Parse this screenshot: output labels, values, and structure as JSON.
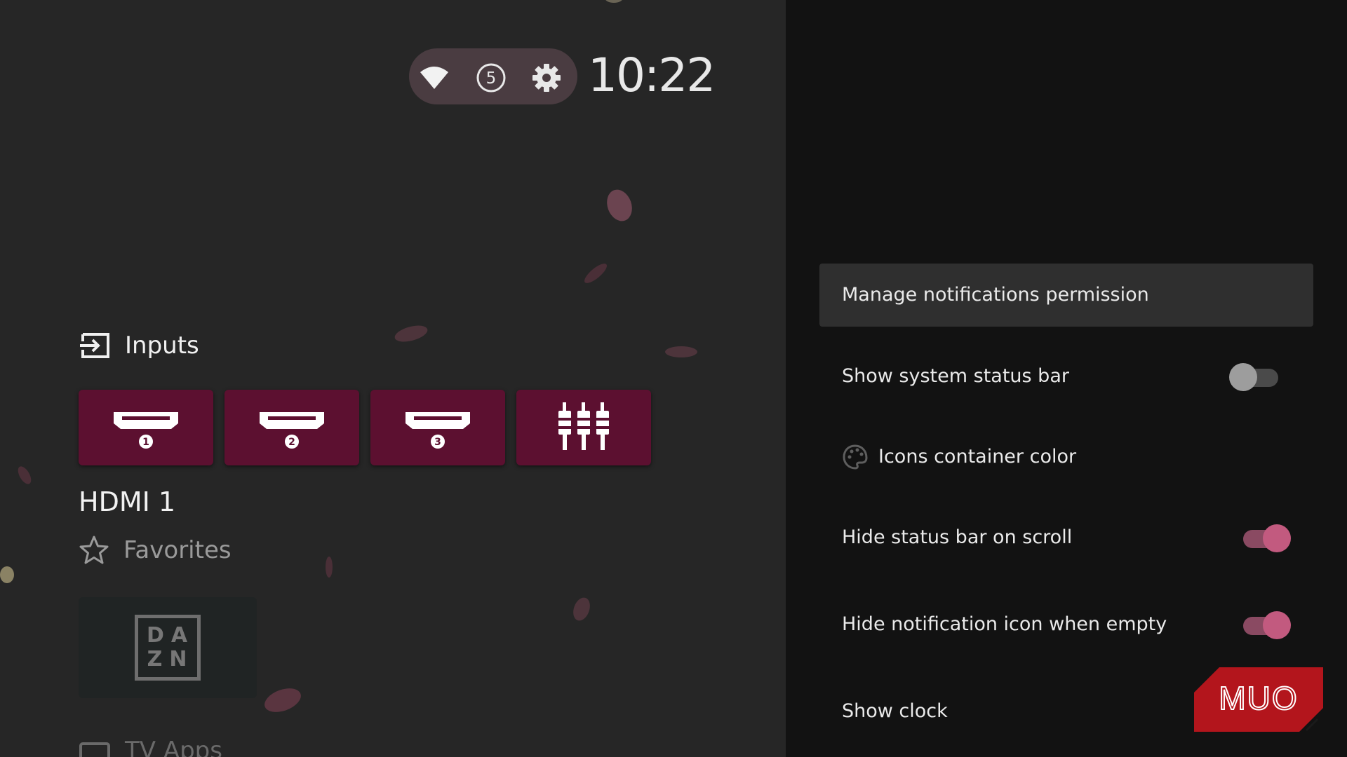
{
  "status_bar": {
    "wifi_icon": "wifi-icon",
    "notification_count": "5",
    "settings_icon": "gear-icon",
    "time": "10:22"
  },
  "home": {
    "inputs": {
      "title": "Inputs",
      "icon": "input-icon",
      "sources": [
        {
          "icon": "hdmi-icon",
          "port": "1"
        },
        {
          "icon": "hdmi-icon",
          "port": "2"
        },
        {
          "icon": "hdmi-icon",
          "port": "3"
        },
        {
          "icon": "composite-av-icon"
        }
      ],
      "focused_label": "HDMI 1"
    },
    "favorites": {
      "title": "Favorites",
      "icon": "star-icon",
      "apps": [
        {
          "name": "DAZN",
          "logo_top": "DA",
          "logo_bottom": "ZN"
        }
      ]
    },
    "tv_apps": {
      "title": "TV Apps",
      "icon": "tv-apps-icon"
    }
  },
  "settings_panel": {
    "items": [
      {
        "label": "Manage notifications permission",
        "type": "action",
        "selected": true
      },
      {
        "label": "Show system status bar",
        "type": "toggle",
        "on": false
      },
      {
        "label": "Icons container color",
        "type": "action",
        "icon": "palette-icon"
      },
      {
        "label": "Hide status bar on scroll",
        "type": "toggle",
        "on": true
      },
      {
        "label": "Hide notification icon when empty",
        "type": "toggle",
        "on": true
      },
      {
        "label": "Show clock",
        "type": "toggle",
        "on": true
      }
    ]
  },
  "watermark": {
    "text": "MUO"
  },
  "colors": {
    "accent": "#c25a7f",
    "tile_background": "#5c1030",
    "panel_background": "#121212",
    "status_pill": "#4a3c41"
  }
}
